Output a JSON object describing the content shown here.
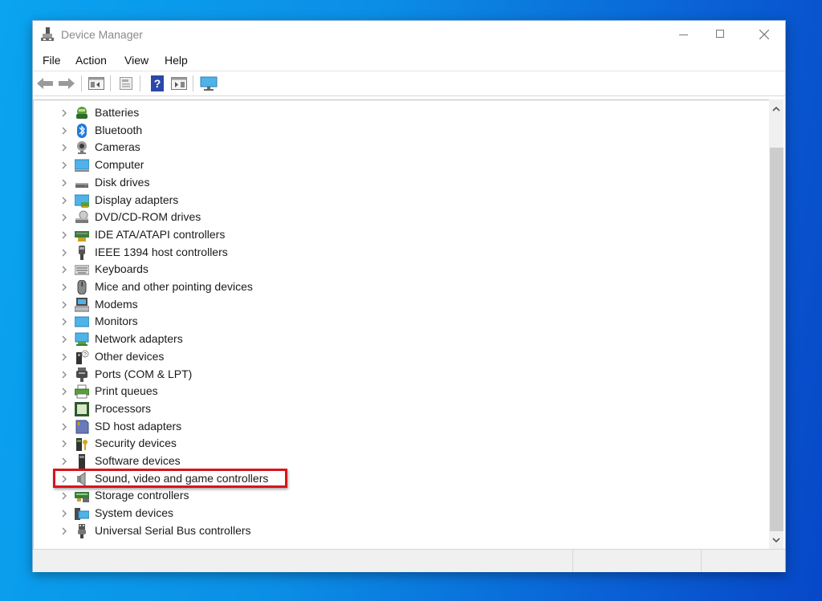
{
  "window": {
    "title": "Device Manager",
    "controls": {
      "minimize": "minimize",
      "maximize": "maximize",
      "close": "close"
    }
  },
  "menubar": {
    "items": [
      {
        "label": "File"
      },
      {
        "label": "Action"
      },
      {
        "label": "View"
      },
      {
        "label": "Help"
      }
    ]
  },
  "toolbar": {
    "buttons": [
      {
        "name": "back",
        "icon": "back-arrow-icon",
        "enabled": false
      },
      {
        "name": "forward",
        "icon": "forward-arrow-icon",
        "enabled": false
      },
      {
        "name": "show-hide-console-tree",
        "icon": "console-tree-icon"
      },
      {
        "name": "properties",
        "icon": "properties-icon"
      },
      {
        "name": "help",
        "icon": "help-icon",
        "glyph": "?"
      },
      {
        "name": "show-hide-action-pane",
        "icon": "action-pane-icon"
      },
      {
        "name": "scan-hardware",
        "icon": "monitor-scan-icon"
      }
    ]
  },
  "tree": {
    "highlighted_index": 21,
    "highlight_color": "#d8141c",
    "items": [
      {
        "label": "Batteries",
        "icon": "battery-icon"
      },
      {
        "label": "Bluetooth",
        "icon": "bluetooth-icon"
      },
      {
        "label": "Cameras",
        "icon": "camera-icon"
      },
      {
        "label": "Computer",
        "icon": "computer-icon"
      },
      {
        "label": "Disk drives",
        "icon": "disk-drive-icon"
      },
      {
        "label": "Display adapters",
        "icon": "display-adapter-icon"
      },
      {
        "label": "DVD/CD-ROM drives",
        "icon": "dvd-drive-icon"
      },
      {
        "label": "IDE ATA/ATAPI controllers",
        "icon": "ide-controller-icon"
      },
      {
        "label": "IEEE 1394 host controllers",
        "icon": "ieee1394-icon"
      },
      {
        "label": "Keyboards",
        "icon": "keyboard-icon"
      },
      {
        "label": "Mice and other pointing devices",
        "icon": "mouse-icon"
      },
      {
        "label": "Modems",
        "icon": "modem-icon"
      },
      {
        "label": "Monitors",
        "icon": "monitor-icon"
      },
      {
        "label": "Network adapters",
        "icon": "network-adapter-icon"
      },
      {
        "label": "Other devices",
        "icon": "other-devices-icon"
      },
      {
        "label": "Ports (COM & LPT)",
        "icon": "port-icon"
      },
      {
        "label": "Print queues",
        "icon": "printer-icon"
      },
      {
        "label": "Processors",
        "icon": "processor-icon"
      },
      {
        "label": "SD host adapters",
        "icon": "sd-card-icon"
      },
      {
        "label": "Security devices",
        "icon": "security-device-icon"
      },
      {
        "label": "Software devices",
        "icon": "software-device-icon"
      },
      {
        "label": "Sound, video and game controllers",
        "icon": "speaker-icon"
      },
      {
        "label": "Storage controllers",
        "icon": "storage-controller-icon"
      },
      {
        "label": "System devices",
        "icon": "system-devices-icon"
      },
      {
        "label": "Universal Serial Bus controllers",
        "icon": "usb-icon"
      }
    ]
  },
  "colors": {
    "highlight": "#d8141c",
    "desktop_left": "#0aa4f0",
    "desktop_right": "#0747c8"
  }
}
